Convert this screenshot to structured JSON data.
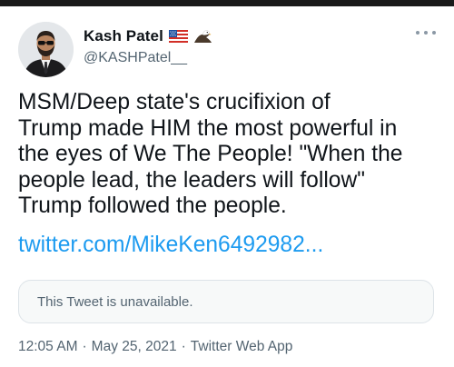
{
  "user": {
    "display_name": "Kash Patel",
    "handle": "@KASHPatel__",
    "badges": [
      "us-flag-icon",
      "eagle-icon"
    ]
  },
  "tweet": {
    "text": "MSM/Deep state's crucifixion of\nTrump made HIM the most powerful in\nthe eyes of We The People! \"When the\npeople lead, the leaders will follow\"\nTrump followed the people.",
    "link": "twitter.com/MikeKen6492982...",
    "quoted_unavailable": "This Tweet is unavailable.",
    "time": "12:05 AM",
    "date": "May 25, 2021",
    "source": "Twitter Web App",
    "separator": "·"
  },
  "colors": {
    "link": "#1d9bf0",
    "secondary_text": "#536471",
    "primary_text": "#0f1419"
  }
}
